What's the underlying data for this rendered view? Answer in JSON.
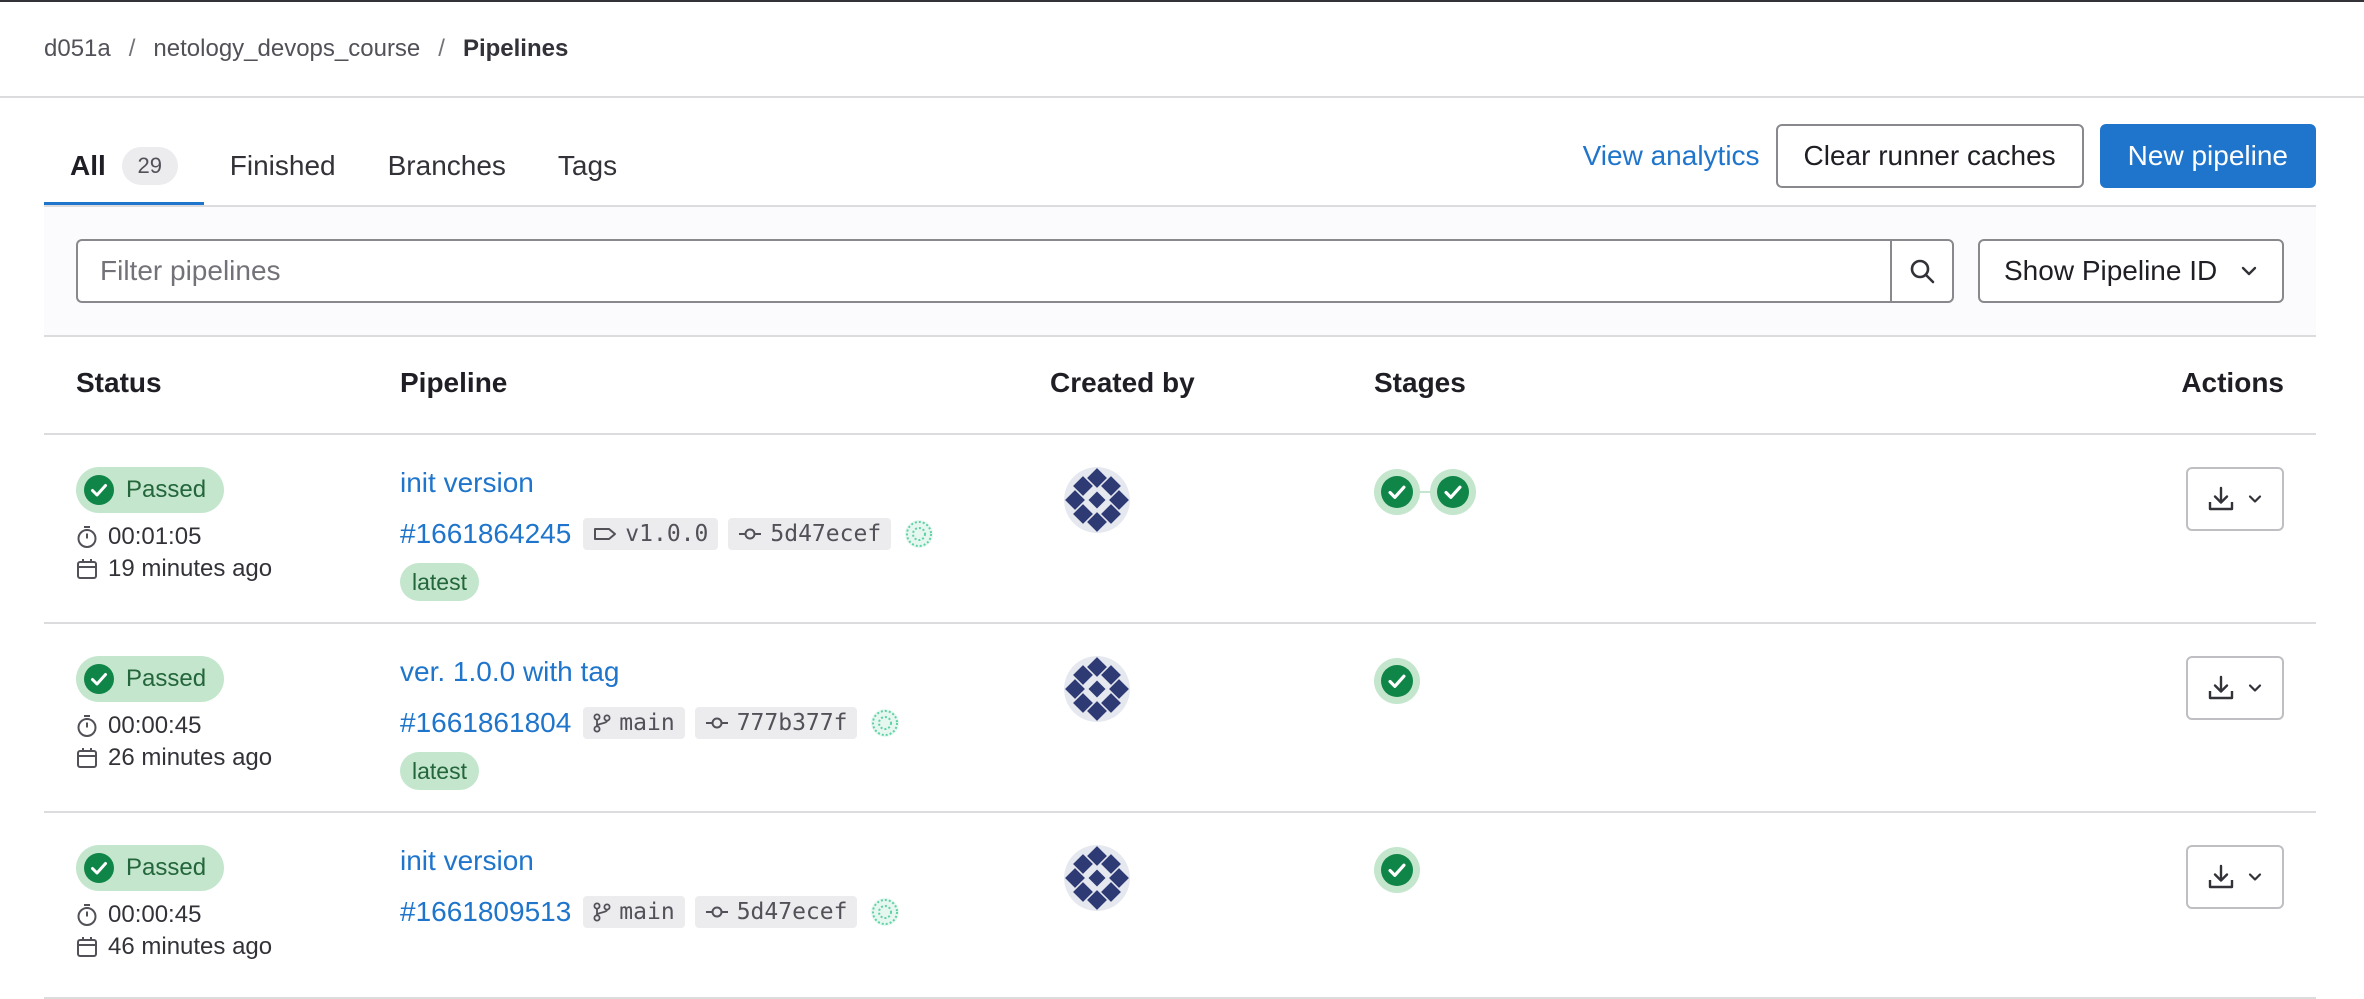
{
  "breadcrumb": {
    "items": [
      "d051a",
      "netology_devops_course"
    ],
    "current": "Pipelines",
    "separator": "/"
  },
  "tabs": [
    {
      "label": "All",
      "count": "29",
      "active": true
    },
    {
      "label": "Finished"
    },
    {
      "label": "Branches"
    },
    {
      "label": "Tags"
    }
  ],
  "header_actions": {
    "view_analytics": "View analytics",
    "clear_caches": "Clear runner caches",
    "new_pipeline": "New pipeline"
  },
  "filter": {
    "placeholder": "Filter pipelines",
    "show_id_label": "Show Pipeline ID"
  },
  "table": {
    "columns": [
      "Status",
      "Pipeline",
      "Created by",
      "Stages",
      "Actions"
    ],
    "rows": [
      {
        "status": "Passed",
        "duration": "00:01:05",
        "finished": "19 minutes ago",
        "title": "init version",
        "id": "#1661864245",
        "ref_type": "tag",
        "ref": "v1.0.0",
        "sha": "5d47ecef",
        "latest": "latest",
        "stages": [
          "passed",
          "passed"
        ]
      },
      {
        "status": "Passed",
        "duration": "00:00:45",
        "finished": "26 minutes ago",
        "title": "ver. 1.0.0 with tag",
        "id": "#1661861804",
        "ref_type": "branch",
        "ref": "main",
        "sha": "777b377f",
        "latest": "latest",
        "stages": [
          "passed"
        ]
      },
      {
        "status": "Passed",
        "duration": "00:00:45",
        "finished": "46 minutes ago",
        "title": "init version",
        "id": "#1661809513",
        "ref_type": "branch",
        "ref": "main",
        "sha": "5d47ecef",
        "stages": [
          "passed"
        ]
      }
    ]
  },
  "colors": {
    "accent": "#1f75cb",
    "success_bg": "#c3e6cd",
    "success_fg": "#24663b",
    "success_icon": "#108548"
  }
}
